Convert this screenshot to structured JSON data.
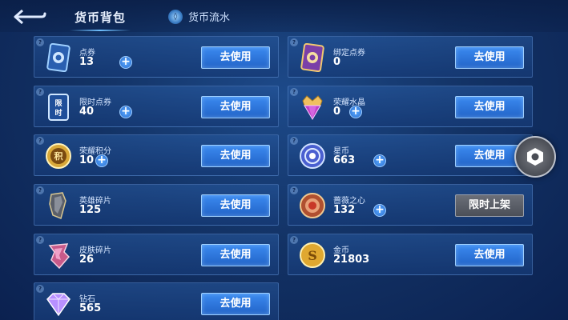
{
  "header": {
    "title": "货币背包",
    "flow_label": "货币流水"
  },
  "buttons": {
    "use_label": "去使用",
    "limited_label": "限时上架"
  },
  "currencies": {
    "voucher": {
      "name": "点券",
      "amount": "13"
    },
    "bound_voucher": {
      "name": "绑定点券",
      "amount": "0"
    },
    "limited_voucher": {
      "name": "限时点券",
      "amount": "40",
      "badge": "限时"
    },
    "honor_crystal": {
      "name": "荣耀水晶",
      "amount": "0"
    },
    "honor_points": {
      "name": "荣耀积分",
      "amount": "10",
      "badge": "积"
    },
    "star_coin": {
      "name": "星币",
      "amount": "663"
    },
    "hero_shards": {
      "name": "英雄碎片",
      "amount": "125"
    },
    "rose_heart": {
      "name": "蔷薇之心",
      "amount": "132"
    },
    "skin_shards": {
      "name": "皮肤碎片",
      "amount": "26"
    },
    "gold": {
      "name": "金币",
      "amount": "21803"
    },
    "diamond": {
      "name": "钻石",
      "amount": "565"
    }
  },
  "colors": {
    "accent": "#2f7ae0",
    "gold": "#e8b84a",
    "background": "#133366"
  },
  "icons": {
    "back": "back-arrow-icon",
    "flow": "currency-flow-icon",
    "float": "hexagon-menu-icon"
  }
}
